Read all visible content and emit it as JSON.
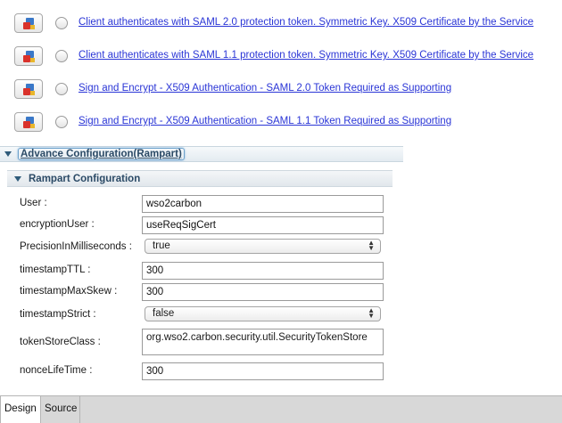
{
  "scenarios": [
    {
      "link": "Client authenticates with SAML 2.0 protection token. Symmetric Key. X509 Certificate by the Service"
    },
    {
      "link": "Client authenticates with SAML 1.1 protection token. Symmetric Key. X509 Certificate by the Service"
    },
    {
      "link": "Sign and Encrypt - X509 Authentication - SAML 2.0 Token Required as Supporting"
    },
    {
      "link": "Sign and Encrypt - X509 Authentication - SAML 1.1 Token Required as Supporting"
    }
  ],
  "advance_section": {
    "title": "Advance Configuration(Rampart)"
  },
  "rampart_section": {
    "title": "Rampart Configuration"
  },
  "form": {
    "user": {
      "label": "User :",
      "value": "wso2carbon"
    },
    "encryption_user": {
      "label": "encryptionUser :",
      "value": "useReqSigCert"
    },
    "precision": {
      "label": "PrecisionInMilliseconds :",
      "value": "true"
    },
    "timestamp_ttl": {
      "label": "timestampTTL :",
      "value": "300"
    },
    "timestamp_max_skew": {
      "label": "timestampMaxSkew :",
      "value": "300"
    },
    "timestamp_strict": {
      "label": "timestampStrict :",
      "value": "false"
    },
    "token_store_class": {
      "label": "tokenStoreClass :",
      "value": "org.wso2.carbon.security.util.SecurityTokenStore"
    },
    "nonce_lifetime": {
      "label": "nonceLifeTime :",
      "value": "300"
    }
  },
  "tabs": {
    "design": "Design",
    "source": "Source"
  },
  "icons": {
    "scenario_button": "shield-lock-icon",
    "collapse": "triangle-down-icon",
    "select_arrows": "updown-arrows-icon"
  },
  "colors": {
    "link": "#2a35d6",
    "section_title": "#2b4a66"
  }
}
